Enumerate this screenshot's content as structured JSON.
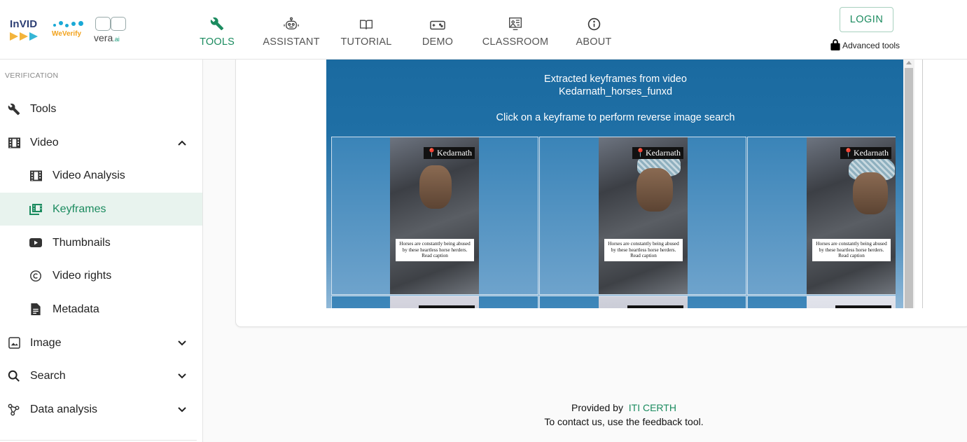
{
  "header": {
    "logos": {
      "invid": "InVID",
      "weverify": "WeVerify",
      "vera": "vera",
      "vera_suffix": ".ai"
    },
    "nav": [
      {
        "id": "tools",
        "label": "TOOLS",
        "icon": "wrench-icon",
        "active": true
      },
      {
        "id": "assistant",
        "label": "ASSISTANT",
        "icon": "robot-icon",
        "active": false
      },
      {
        "id": "tutorial",
        "label": "TUTORIAL",
        "icon": "book-icon",
        "active": false
      },
      {
        "id": "demo",
        "label": "DEMO",
        "icon": "gamepad-icon",
        "active": false
      },
      {
        "id": "classroom",
        "label": "CLASSROOM",
        "icon": "classroom-icon",
        "active": false
      },
      {
        "id": "about",
        "label": "ABOUT",
        "icon": "info-icon",
        "active": false
      }
    ],
    "login_label": "LOGIN",
    "advanced_tools_label": "Advanced tools"
  },
  "sidebar": {
    "section_label": "VERIFICATION",
    "items": [
      {
        "label": "Tools",
        "icon": "wrench-icon",
        "level": 0,
        "expandable": false,
        "expanded": false,
        "selected": false
      },
      {
        "label": "Video",
        "icon": "film-icon",
        "level": 0,
        "expandable": true,
        "expanded": true,
        "selected": false
      },
      {
        "label": "Video Analysis",
        "icon": "film-icon",
        "level": 1,
        "expandable": false,
        "expanded": false,
        "selected": false
      },
      {
        "label": "Keyframes",
        "icon": "keyframes-icon",
        "level": 1,
        "expandable": false,
        "expanded": false,
        "selected": true
      },
      {
        "label": "Thumbnails",
        "icon": "youtube-icon",
        "level": 1,
        "expandable": false,
        "expanded": false,
        "selected": false
      },
      {
        "label": "Video rights",
        "icon": "copyright-icon",
        "level": 1,
        "expandable": false,
        "expanded": false,
        "selected": false
      },
      {
        "label": "Metadata",
        "icon": "document-icon",
        "level": 1,
        "expandable": false,
        "expanded": false,
        "selected": false
      },
      {
        "label": "Image",
        "icon": "image-icon",
        "level": 0,
        "expandable": true,
        "expanded": false,
        "selected": false
      },
      {
        "label": "Search",
        "icon": "search-icon",
        "level": 0,
        "expandable": true,
        "expanded": false,
        "selected": false
      },
      {
        "label": "Data analysis",
        "icon": "graph-icon",
        "level": 0,
        "expandable": true,
        "expanded": false,
        "selected": false
      }
    ]
  },
  "keyframes_panel": {
    "title_line1": "Extracted keyframes from video",
    "title_line2": "Kedarnath_horses_funxd",
    "instruction": "Click on a keyframe to perform reverse image search",
    "frames": [
      {
        "tag": "Kedarnath",
        "caption": "Horses are constantly being abused by these heartless horse herders. Read caption"
      },
      {
        "tag": "Kedarnath",
        "caption": "Horses are constantly being abused by these heartless horse herders. Read caption"
      },
      {
        "tag": "Kedarnath",
        "caption": "Horses are constantly being abused by these heartless horse herders. Read caption"
      }
    ]
  },
  "footer": {
    "provided_by": "Provided by",
    "provider_link": "ITI CERTH",
    "contact": "To contact us, use the feedback tool."
  },
  "colors": {
    "accent": "#1b8b5f",
    "selected_bg": "#e8f3ee",
    "panel_blue": "#1f6fa5"
  }
}
